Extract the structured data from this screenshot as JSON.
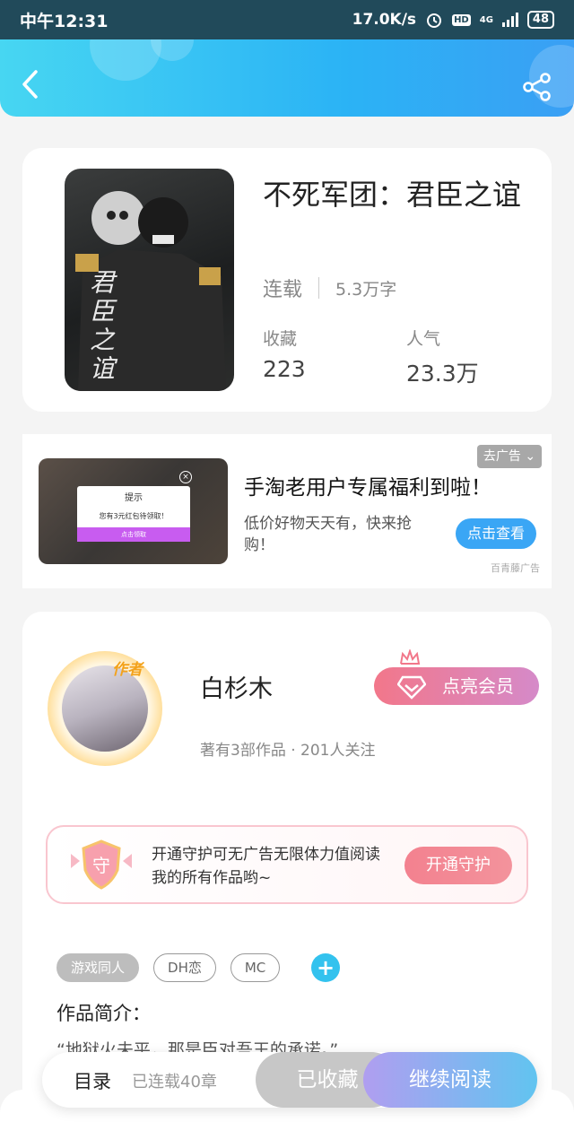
{
  "status_bar": {
    "time": "中午12:31",
    "speed": "17.0K/s",
    "hd": "HD",
    "network": "4G",
    "battery": "48"
  },
  "header": {
    "back_icon": "chevron-left-icon",
    "share_icon": "share-icon",
    "gradient": [
      "#47d6f2",
      "#3a9ff4"
    ]
  },
  "book": {
    "title": "不死军团：君臣之谊",
    "cover_text": "君臣之谊",
    "status": "连载",
    "word_count": "5.3万字",
    "favorites_label": "收藏",
    "favorites_value": "223",
    "popularity_label": "人气",
    "popularity_value": "23.3万"
  },
  "ad": {
    "title": "手淘老用户专属福利到啦！",
    "description": "低价好物天天有，快来抢购！",
    "button": "点击查看",
    "remove_tag": "去广告",
    "source": "百青藤广告",
    "popup_title": "提示",
    "popup_message": "您有3元红包待领取！",
    "popup_button": "点击领取"
  },
  "author": {
    "badge": "作者",
    "name": "白杉木",
    "meta": "著有3部作品 · 201人关注",
    "vip_button": "点亮会员",
    "guard_icon_char": "守",
    "guard_text": "开通守护可无广告无限体力值阅读我的所有作品哟~",
    "guard_button": "开通守护"
  },
  "tags": [
    "游戏同人",
    "DH恋",
    "MC"
  ],
  "intro": {
    "title": "作品简介：",
    "text": "“地狱火未平，那是臣对吾王的承诺。”"
  },
  "bottom_bar": {
    "toc_label": "目录",
    "toc_sub": "已连载40章",
    "favorite_button": "已收藏",
    "read_button": "继续阅读"
  }
}
